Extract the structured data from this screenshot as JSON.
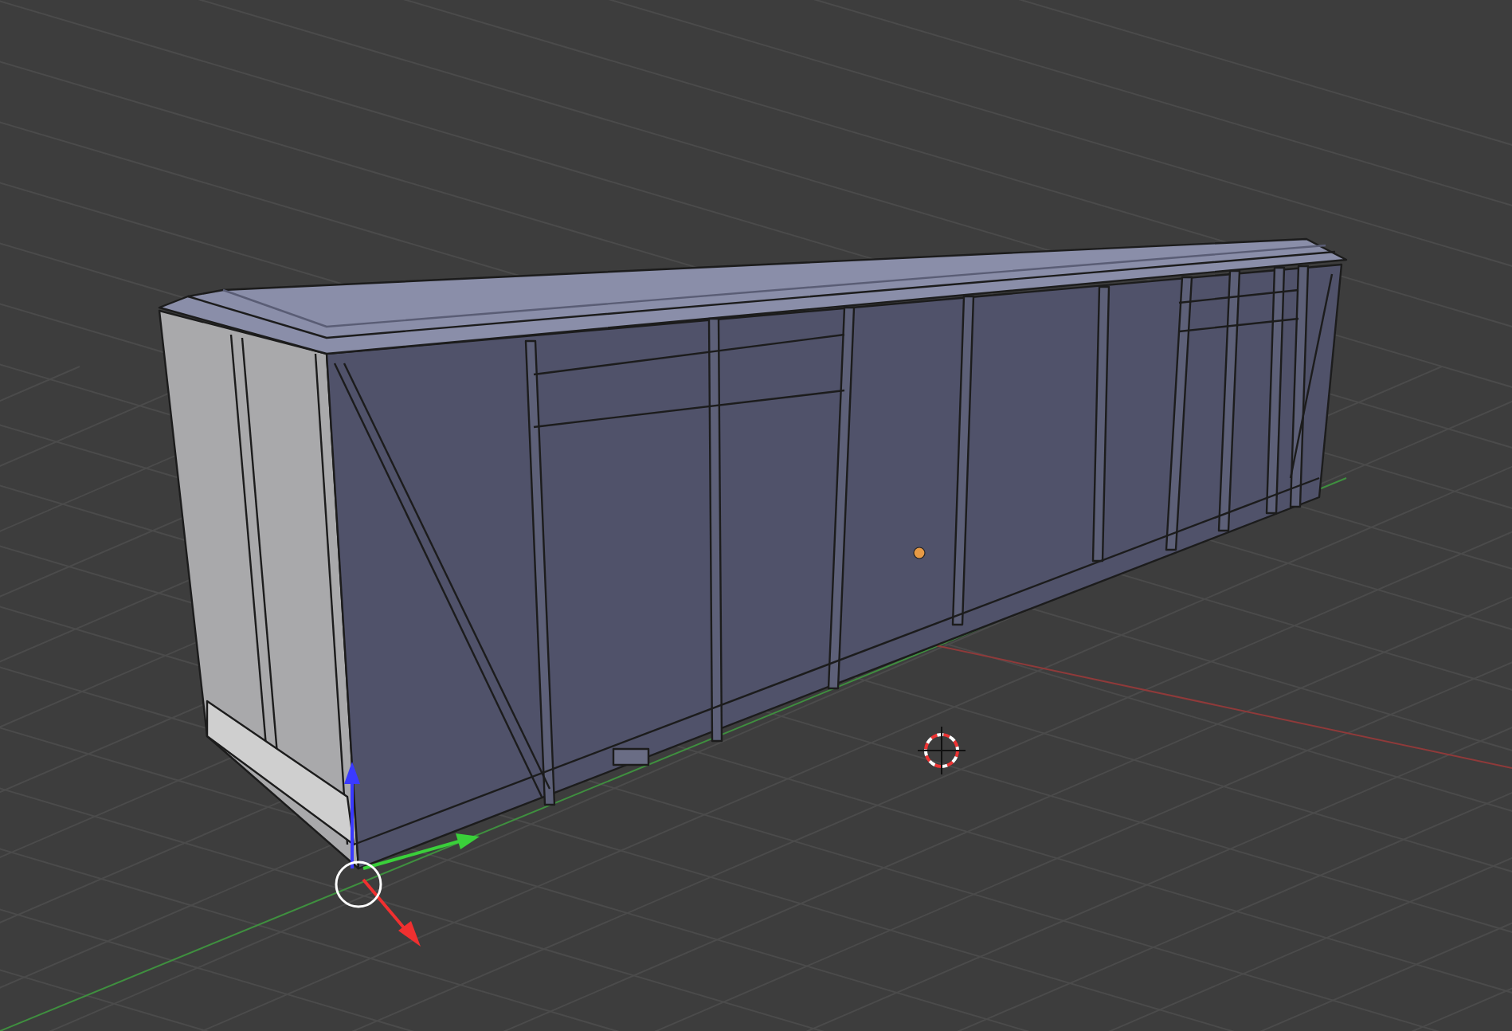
{
  "viewport": {
    "objects": [
      {
        "kind": "boxcar"
      }
    ]
  }
}
